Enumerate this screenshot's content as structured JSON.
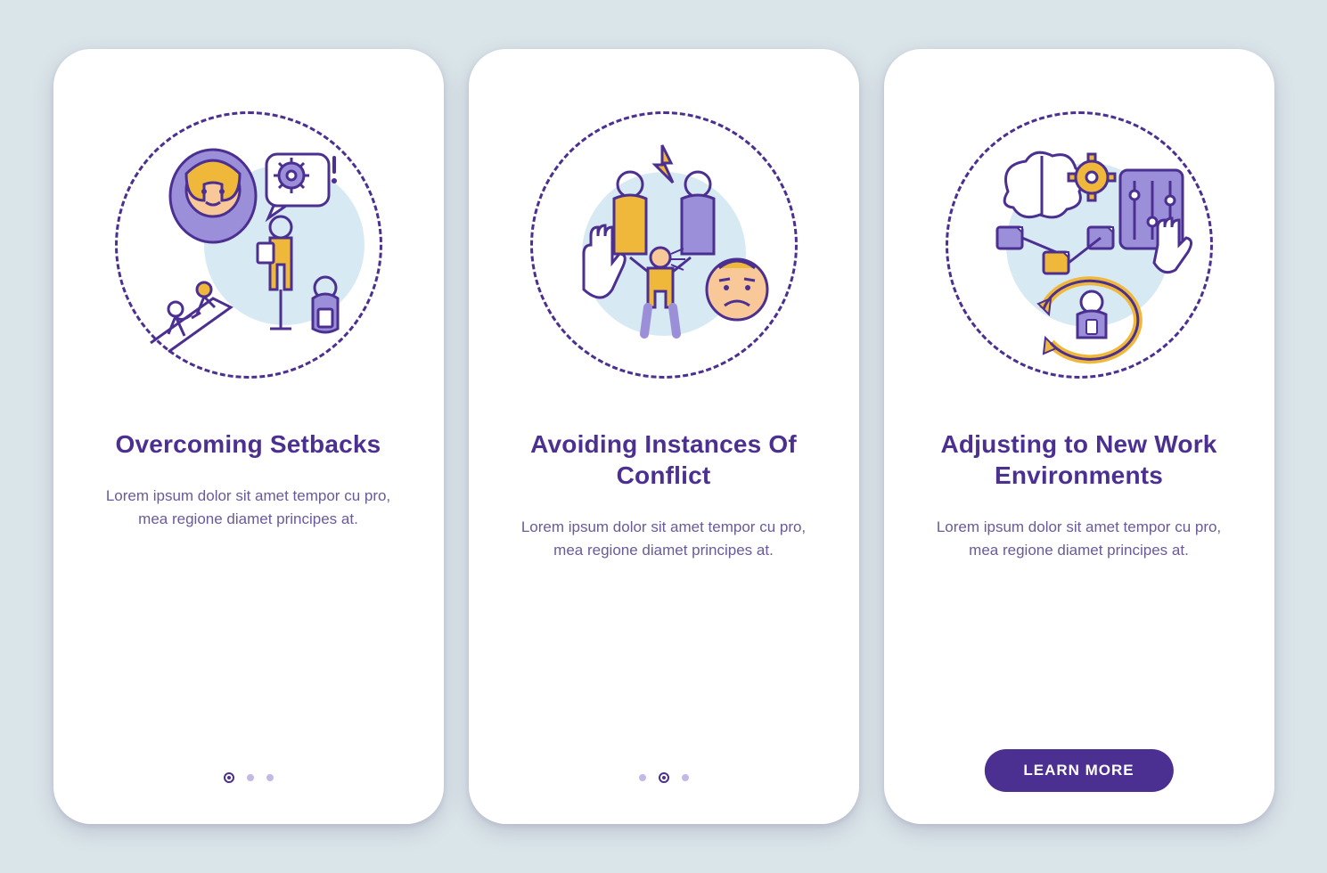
{
  "colors": {
    "primary": "#4b2f91",
    "accent": "#f0b83a",
    "skin": "#f8c898",
    "soft": "#d7e9f2",
    "line": "#4b2f91",
    "bg": "#dae5e9"
  },
  "screens": [
    {
      "illustration": "overcoming-setbacks-icon",
      "title": "Overcoming Setbacks",
      "body": "Lorem ipsum dolor sit amet tempor cu pro, mea regione diamet principes at.",
      "pagination": {
        "total": 3,
        "active": 0
      },
      "cta": null
    },
    {
      "illustration": "avoiding-conflict-icon",
      "title": "Avoiding Instances Of Conflict",
      "body": "Lorem ipsum dolor sit amet tempor cu pro, mea regione diamet principes at.",
      "pagination": {
        "total": 3,
        "active": 1
      },
      "cta": null
    },
    {
      "illustration": "new-work-environments-icon",
      "title": "Adjusting to New Work Environments",
      "body": "Lorem ipsum dolor sit amet tempor cu pro, mea regione diamet principes at.",
      "pagination": null,
      "cta": "LEARN MORE"
    }
  ]
}
